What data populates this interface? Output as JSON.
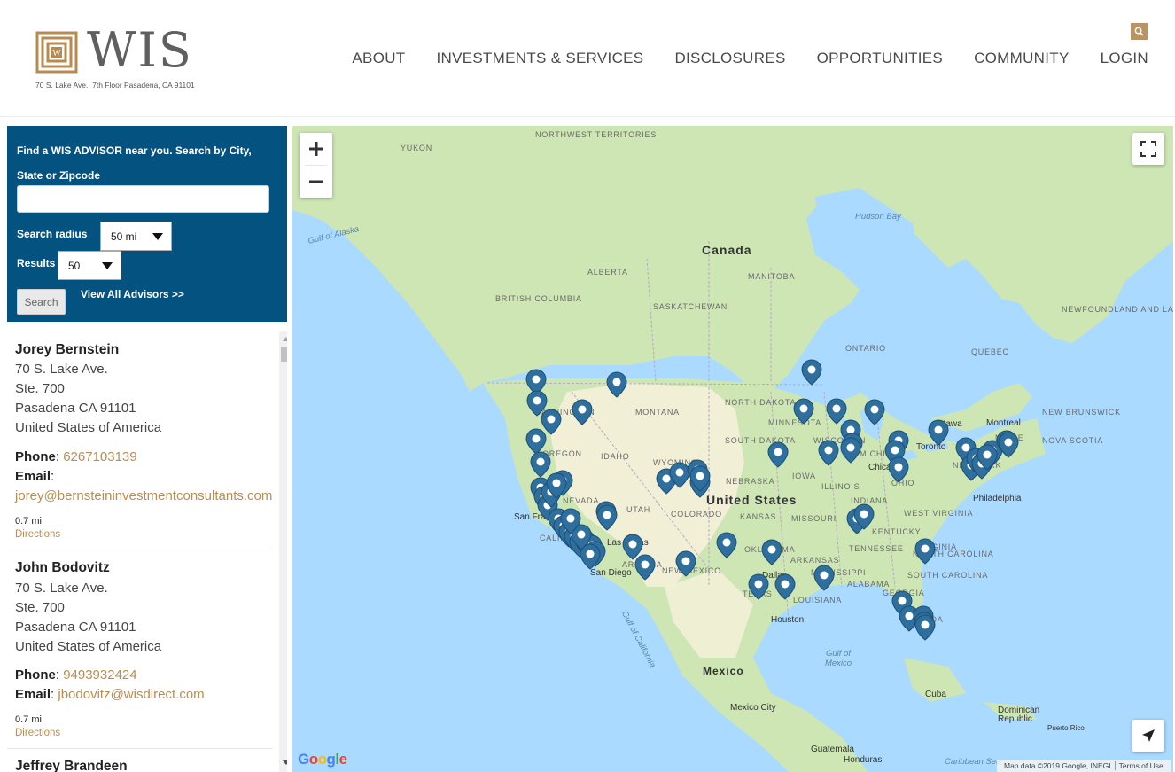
{
  "header": {
    "logo_text": "WIS",
    "address": "70 S. Lake Ave., 7th Floor Pasadena, CA 91101",
    "nav": [
      "ABOUT",
      "INVESTMENTS & SERVICES",
      "DISCLOSURES",
      "OPPORTUNITIES",
      "COMMUNITY",
      "LOGIN"
    ]
  },
  "finder": {
    "intro": "Find a WIS ADVISOR near you. Search by City, State or Zipcode",
    "location_value": "",
    "radius_label": "Search radius",
    "radius_value": "50 mi",
    "results_label": "Results",
    "results_value": "50",
    "search_button": "Search",
    "view_all": "View All Advisors >>"
  },
  "advisors": [
    {
      "name": "Jorey Bernstein",
      "address": [
        "70 S. Lake Ave.",
        "Ste. 700",
        "Pasadena CA 91101",
        "United States of America"
      ],
      "phone_label": "Phone",
      "phone": "6267103139",
      "email_label": "Email",
      "email": "jorey@bernsteininvestmentconsultants.com",
      "distance": "0.7 mi",
      "directions": "Directions"
    },
    {
      "name": "John Bodovitz",
      "address": [
        "70 S. Lake Ave.",
        "Ste. 700",
        "Pasadena CA 91101",
        "United States of America"
      ],
      "phone_label": "Phone",
      "phone": "9493932424",
      "email_label": "Email",
      "email": "jbodovitz@wisdirect.com",
      "distance": "0.7 mi",
      "directions": "Directions"
    },
    {
      "name": "Jeffrey Brandeen"
    }
  ],
  "map": {
    "labels": {
      "countries": [
        "Canada",
        "United States",
        "Mexico"
      ],
      "states": [
        "NORTHWEST TERRITORIES",
        "YUKON",
        "ALBERTA",
        "MANITOBA",
        "BRITISH COLUMBIA",
        "SASKATCHEWAN",
        "ONTARIO",
        "QUEBEC",
        "NEWFOUNDLAND AND LABRADOR",
        "NEW BRUNSWICK",
        "NOVA SCOTIA",
        "MAINE",
        "NEW YORK",
        "WASHINGTON",
        "MONTANA",
        "NORTH DAKOTA",
        "MINNESOTA",
        "SOUTH DAKOTA",
        "WISCONSIN",
        "MICHIGAN",
        "OREGON",
        "IDAHO",
        "WYOMING",
        "NEBRASKA",
        "IOWA",
        "ILLINOIS",
        "INDIANA",
        "OHIO",
        "NEVADA",
        "UTAH",
        "COLORADO",
        "KANSAS",
        "MISSOURI",
        "KENTUCKY",
        "WEST VIRGINIA",
        "VIRGINIA",
        "CALIFORNIA",
        "ARIZONA",
        "NEW MEXICO",
        "OKLAHOMA",
        "ARKANSAS",
        "TENNESSEE",
        "NORTH CAROLINA",
        "SOUTH CAROLINA",
        "MISSISSIPPI",
        "ALABAMA",
        "GEORGIA",
        "TEXAS",
        "LOUISIANA",
        "FLORIDA"
      ],
      "cities": [
        "Ottawa",
        "Montreal",
        "Toronto",
        "Chicago",
        "Philadelphia",
        "San Francisco",
        "Las Vegas",
        "San Diego",
        "Dallas",
        "Houston",
        "Mexico City",
        "Guatemala",
        "Honduras",
        "Cuba",
        "Dominican Republic",
        "Puerto Rico"
      ],
      "water": [
        "Hudson Bay",
        "Gulf of Alaska",
        "Gulf of Mexico",
        "Gulf of California",
        "Caribbean Sea"
      ]
    },
    "zoom_in": "+",
    "zoom_out": "−",
    "attribution": "Map data ©2019 Google, INEGI",
    "terms": "Terms of Use",
    "google_logo": "Google",
    "colors": {
      "pin": "#2e6f9e",
      "water": "#aadaff",
      "land": "#cde6b4",
      "desert": "#f5f0d9"
    },
    "icons": [
      "fullscreen-icon",
      "my-location-icon",
      "search-icon",
      "map-pin-icon"
    ]
  }
}
